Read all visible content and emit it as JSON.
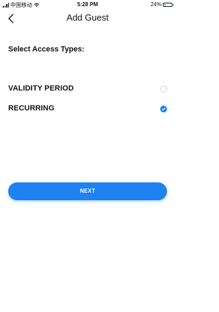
{
  "status_bar": {
    "carrier": "中国移动",
    "time": "5:28 PM",
    "battery_text": "24%",
    "battery_level": 0.24
  },
  "nav": {
    "title": "Add Guest",
    "back_icon": "chevron-left-icon"
  },
  "section_title": "Select Access Types:",
  "options": [
    {
      "label": "VALIDITY PERIOD",
      "selected": false
    },
    {
      "label": "RECURRING",
      "selected": true
    }
  ],
  "next_label": "NEXT",
  "colors": {
    "accent": "#1e82f0",
    "text": "#111111",
    "radio_off": "#d2d2d2"
  }
}
